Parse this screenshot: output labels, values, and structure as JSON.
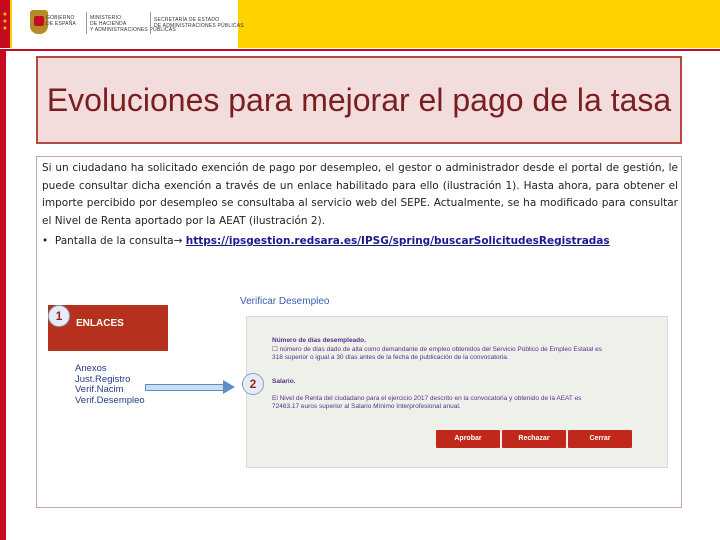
{
  "header": {
    "gov_line1": "GOBIERNO",
    "gov_line2": "DE ESPAÑA",
    "ministry_line1": "MINISTERIO",
    "ministry_line2": "DE HACIENDA",
    "ministry_line3": "Y ADMINISTRACIONES PÚBLICAS",
    "secretariat_line1": "SECRETARÍA DE ESTADO",
    "secretariat_line2": "DE ADMINISTRACIONES PÚBLICAS"
  },
  "title": "Evoluciones para mejorar el pago de la tasa",
  "body": {
    "paragraph": "Si un ciudadano ha solicitado exención de pago por desempleo, el gestor o administrador desde el portal de gestión, le puede consultar dicha exención a través de un enlace habilitado para ello (ilustración 1). Hasta ahora, para obtener el importe percibido por desempleo se consultaba al servicio web del SEPE. Actualmente, se ha modificado para consultar el Nivel de Renta aportado por la AEAT (ilustración 2).",
    "bullet_prefix": "Pantalla de la consulta→",
    "bullet_link": "https://ipsgestion.redsara.es/IPSG/spring/buscarSolicitudesRegistradas"
  },
  "illustration1": {
    "badge": "1",
    "enlaces_label": "ENLACES",
    "links": [
      "Anexos",
      "Just.Registro",
      "Verif.Nacim",
      "Verif.Desempleo"
    ]
  },
  "illustration2": {
    "badge": "2",
    "title": "Verificar Desempleo",
    "days_header": "Número de días desempleado.",
    "days_line1": "☐ número de días dado de alta como demandante de empleo obtenidos del Servicio Público de Empleo Estatal es",
    "days_line2": "318 superior o igual a 30 días antes de la fecha de publicación de la convocatoria.",
    "salary_header": "Salario.",
    "salary_line1": "El Nivel de Renta del ciudadano para el ejercicio 2017 descrito en la convocatoria y obtenido de la AEAT es",
    "salary_line2": "72463.17 euros superior al Salario Mínimo Interprofesional anual.",
    "buttons": [
      "Aprobar",
      "Rechazar",
      "Cerrar"
    ]
  },
  "colors": {
    "header_yellow": "#ffd200",
    "spain_red": "#c60b1e",
    "title_text": "#7a1f1f",
    "title_bg": "#f3dcdc",
    "enlaces_red": "#b5311d",
    "button_red": "#c0281c",
    "link_blue": "#1a1a8c"
  }
}
